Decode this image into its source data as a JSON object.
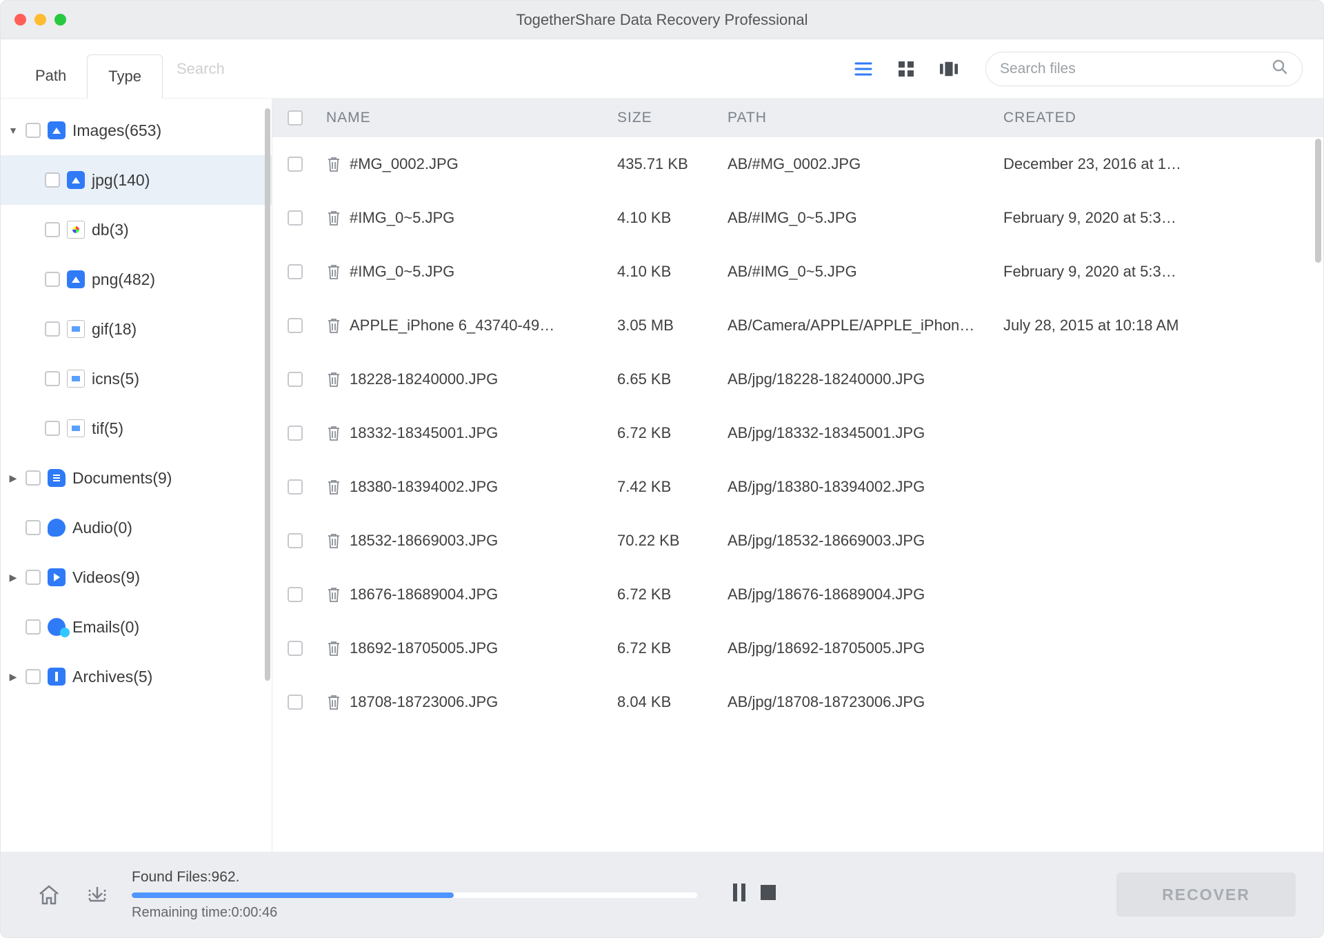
{
  "window": {
    "title": "TogetherShare Data Recovery Professional"
  },
  "toolbar": {
    "tabs": {
      "path": "Path",
      "type": "Type"
    },
    "search_hint": "Search",
    "filesearch_placeholder": "Search files"
  },
  "sidebar": {
    "images": {
      "label": "Images(653)"
    },
    "jpg": {
      "label": "jpg(140)"
    },
    "db": {
      "label": "db(3)"
    },
    "png": {
      "label": "png(482)"
    },
    "gif": {
      "label": "gif(18)"
    },
    "icns": {
      "label": "icns(5)"
    },
    "tif": {
      "label": "tif(5)"
    },
    "documents": {
      "label": "Documents(9)"
    },
    "audio": {
      "label": "Audio(0)"
    },
    "videos": {
      "label": "Videos(9)"
    },
    "emails": {
      "label": "Emails(0)"
    },
    "archives": {
      "label": "Archives(5)"
    }
  },
  "columns": {
    "name": "NAME",
    "size": "SIZE",
    "path": "PATH",
    "created": "CREATED"
  },
  "rows": [
    {
      "name": "#MG_0002.JPG",
      "size": "435.71 KB",
      "path": "AB/#MG_0002.JPG",
      "created": "December 23, 2016 at 1…"
    },
    {
      "name": "#IMG_0~5.JPG",
      "size": "4.10 KB",
      "path": "AB/#IMG_0~5.JPG",
      "created": "February 9, 2020 at 5:3…"
    },
    {
      "name": "#IMG_0~5.JPG",
      "size": "4.10 KB",
      "path": "AB/#IMG_0~5.JPG",
      "created": "February 9, 2020 at 5:3…"
    },
    {
      "name": "APPLE_iPhone 6_43740-49…",
      "size": "3.05 MB",
      "path": "AB/Camera/APPLE/APPLE_iPhon…",
      "created": "July 28, 2015 at 10:18 AM"
    },
    {
      "name": "18228-18240000.JPG",
      "size": "6.65 KB",
      "path": "AB/jpg/18228-18240000.JPG",
      "created": ""
    },
    {
      "name": "18332-18345001.JPG",
      "size": "6.72 KB",
      "path": "AB/jpg/18332-18345001.JPG",
      "created": ""
    },
    {
      "name": "18380-18394002.JPG",
      "size": "7.42 KB",
      "path": "AB/jpg/18380-18394002.JPG",
      "created": ""
    },
    {
      "name": "18532-18669003.JPG",
      "size": "70.22 KB",
      "path": "AB/jpg/18532-18669003.JPG",
      "created": ""
    },
    {
      "name": "18676-18689004.JPG",
      "size": "6.72 KB",
      "path": "AB/jpg/18676-18689004.JPG",
      "created": ""
    },
    {
      "name": "18692-18705005.JPG",
      "size": "6.72 KB",
      "path": "AB/jpg/18692-18705005.JPG",
      "created": ""
    },
    {
      "name": "18708-18723006.JPG",
      "size": "8.04 KB",
      "path": "AB/jpg/18708-18723006.JPG",
      "created": ""
    }
  ],
  "footer": {
    "found": "Found Files:962.",
    "remaining": "Remaining time:0:00:46",
    "progress_pct": 57,
    "recover": "RECOVER"
  }
}
